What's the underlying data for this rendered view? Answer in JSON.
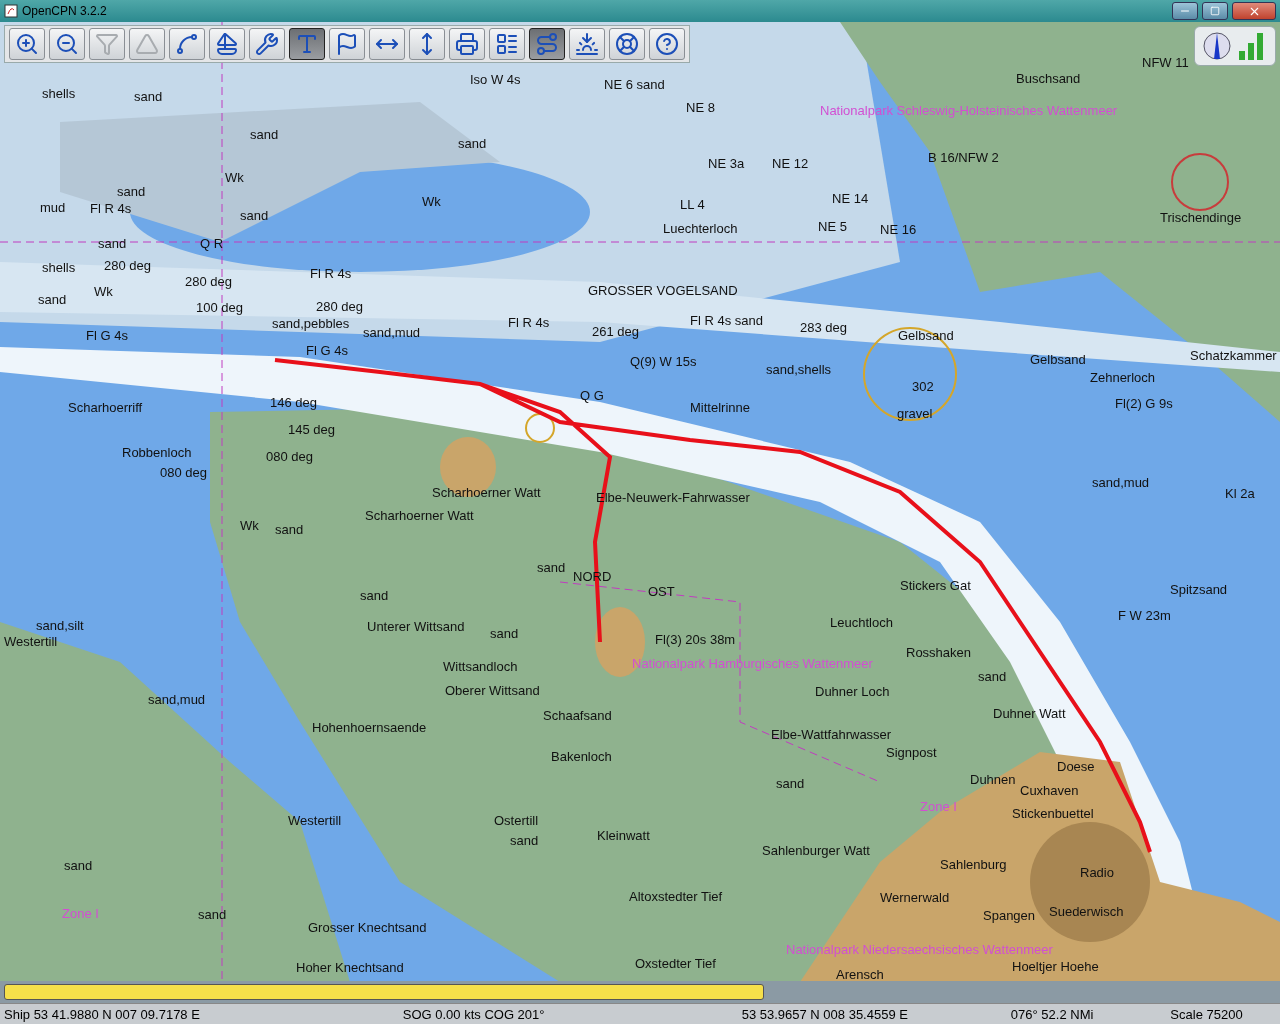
{
  "window": {
    "title": "OpenCPN 3.2.2"
  },
  "toolbar": [
    {
      "on": false,
      "disabled": false
    },
    {
      "on": false,
      "disabled": false
    },
    {
      "on": false,
      "disabled": true
    },
    {
      "on": false,
      "disabled": true
    },
    {
      "on": false,
      "disabled": false
    },
    {
      "on": false,
      "disabled": false
    },
    {
      "on": false,
      "disabled": false
    },
    {
      "on": true,
      "disabled": false
    },
    {
      "on": false,
      "disabled": false
    },
    {
      "on": false,
      "disabled": false
    },
    {
      "on": false,
      "disabled": false
    },
    {
      "on": false,
      "disabled": false
    },
    {
      "on": false,
      "disabled": false
    },
    {
      "on": true,
      "disabled": false
    },
    {
      "on": false,
      "disabled": false
    },
    {
      "on": false,
      "disabled": false
    },
    {
      "on": false,
      "disabled": false
    }
  ],
  "chart_labels": [
    {
      "text": "shells",
      "kind": "place"
    },
    {
      "text": "sand",
      "kind": "place"
    },
    {
      "text": "sand",
      "kind": "place"
    },
    {
      "text": "sand",
      "kind": "place"
    },
    {
      "text": "sand",
      "kind": "place"
    },
    {
      "text": "Wk",
      "kind": "place"
    },
    {
      "text": "mud",
      "kind": "place"
    },
    {
      "text": "Fl R 4s",
      "kind": "place"
    },
    {
      "text": "sand",
      "kind": "place"
    },
    {
      "text": "Wk",
      "kind": "place"
    },
    {
      "text": "sand",
      "kind": "place"
    },
    {
      "text": "Q R",
      "kind": "place"
    },
    {
      "text": "shells",
      "kind": "place"
    },
    {
      "text": "280 deg",
      "kind": "place"
    },
    {
      "text": "Fl R 4s",
      "kind": "place"
    },
    {
      "text": "280 deg",
      "kind": "place"
    },
    {
      "text": "Wk",
      "kind": "place"
    },
    {
      "text": "sand",
      "kind": "place"
    },
    {
      "text": "100 deg",
      "kind": "place"
    },
    {
      "text": "280 deg",
      "kind": "place"
    },
    {
      "text": "GROSSER VOGELSAND",
      "kind": "place"
    },
    {
      "text": "Fl G 4s",
      "kind": "place"
    },
    {
      "text": "sand,pebbles",
      "kind": "place"
    },
    {
      "text": "sand,mud",
      "kind": "place"
    },
    {
      "text": "Fl R 4s",
      "kind": "place"
    },
    {
      "text": "261 deg",
      "kind": "place"
    },
    {
      "text": "Fl R 4s sand",
      "kind": "place"
    },
    {
      "text": "283 deg",
      "kind": "place"
    },
    {
      "text": "Fl G 4s",
      "kind": "place"
    },
    {
      "text": "Gelbsand",
      "kind": "place"
    },
    {
      "text": "Q(9) W 15s",
      "kind": "place"
    },
    {
      "text": "Q G",
      "kind": "place"
    },
    {
      "text": "Mittelrinne",
      "kind": "place"
    },
    {
      "text": "sand,shells",
      "kind": "place"
    },
    {
      "text": "302",
      "kind": "place"
    },
    {
      "text": "gravel",
      "kind": "place"
    },
    {
      "text": "Scharhoerriff",
      "kind": "place"
    },
    {
      "text": "146 deg",
      "kind": "place"
    },
    {
      "text": "145 deg",
      "kind": "place"
    },
    {
      "text": "080 deg",
      "kind": "place"
    },
    {
      "text": "Robbenloch",
      "kind": "place"
    },
    {
      "text": "080 deg",
      "kind": "place"
    },
    {
      "text": "Scharhoerner Watt",
      "kind": "place"
    },
    {
      "text": "Scharhoerner Watt",
      "kind": "place"
    },
    {
      "text": "Elbe-Neuwerk-Fahrwasser",
      "kind": "place"
    },
    {
      "text": "sand",
      "kind": "place"
    },
    {
      "text": "sand",
      "kind": "place"
    },
    {
      "text": "NORD",
      "kind": "place"
    },
    {
      "text": "OST",
      "kind": "place"
    },
    {
      "text": "Fl(3) 20s 38m",
      "kind": "place"
    },
    {
      "text": "Nationalpark Hamburgisches Wattenmeer",
      "kind": "zone"
    },
    {
      "text": "sand",
      "kind": "place"
    },
    {
      "text": "Unterer Wittsand",
      "kind": "place"
    },
    {
      "text": "sand",
      "kind": "place"
    },
    {
      "text": "Wittsandloch",
      "kind": "place"
    },
    {
      "text": "Oberer Wittsand",
      "kind": "place"
    },
    {
      "text": "Schaafsand",
      "kind": "place"
    },
    {
      "text": "Bakenloch",
      "kind": "place"
    },
    {
      "text": "Hohenhoernsaende",
      "kind": "place"
    },
    {
      "text": "Westertill",
      "kind": "place"
    },
    {
      "text": "Ostertill",
      "kind": "place"
    },
    {
      "text": "Kleinwatt",
      "kind": "place"
    },
    {
      "text": "Sahlenburger Watt",
      "kind": "place"
    },
    {
      "text": "Altoxstedter Tief",
      "kind": "place"
    },
    {
      "text": "Grosser Knechtsand",
      "kind": "place"
    },
    {
      "text": "Hoher Knechtsand",
      "kind": "place"
    },
    {
      "text": "Oxstedter Tief",
      "kind": "place"
    },
    {
      "text": "Wernerwald",
      "kind": "place"
    },
    {
      "text": "Sahlenburg",
      "kind": "place"
    },
    {
      "text": "Spangen",
      "kind": "place"
    },
    {
      "text": "Suederwisch",
      "kind": "place"
    },
    {
      "text": "Radio",
      "kind": "place"
    },
    {
      "text": "Duhnen",
      "kind": "place"
    },
    {
      "text": "Doese",
      "kind": "place"
    },
    {
      "text": "Cuxhaven",
      "kind": "place"
    },
    {
      "text": "Stickenbuettel",
      "kind": "place"
    },
    {
      "text": "Hoeltjer Hoehe",
      "kind": "place"
    },
    {
      "text": "Nationalpark Niedersaechsisches Wattenmeer",
      "kind": "zone"
    },
    {
      "text": "Arensch",
      "kind": "place"
    },
    {
      "text": "Signpost",
      "kind": "place"
    },
    {
      "text": "Duhner Loch",
      "kind": "place"
    },
    {
      "text": "Duhner Watt",
      "kind": "place"
    },
    {
      "text": "Rosshaken",
      "kind": "place"
    },
    {
      "text": "Leuchtloch",
      "kind": "place"
    },
    {
      "text": "Elbe-Wattfahrwasser",
      "kind": "place"
    },
    {
      "text": "Stickers Gat",
      "kind": "place"
    },
    {
      "text": "Zone I",
      "kind": "zone"
    },
    {
      "text": "Luechterloch",
      "kind": "place"
    },
    {
      "text": "LL 4",
      "kind": "place"
    },
    {
      "text": "Nationalpark Schleswig-Holsteinisches Wattenmeer",
      "kind": "zone"
    },
    {
      "text": "Buschsand",
      "kind": "place"
    },
    {
      "text": "NFW 11",
      "kind": "place"
    },
    {
      "text": "Trischendinge",
      "kind": "place"
    },
    {
      "text": "Schatzkammer",
      "kind": "place"
    },
    {
      "text": "Gelbsand",
      "kind": "place"
    },
    {
      "text": "Zehnerloch",
      "kind": "place"
    },
    {
      "text": "Spitzsand",
      "kind": "place"
    },
    {
      "text": "sand,mud",
      "kind": "place"
    },
    {
      "text": "NE 6 sand",
      "kind": "place"
    },
    {
      "text": "NE 8",
      "kind": "place"
    },
    {
      "text": "NE 3a",
      "kind": "place"
    },
    {
      "text": "NE 12",
      "kind": "place"
    },
    {
      "text": "NE 14",
      "kind": "place"
    },
    {
      "text": "NE 5",
      "kind": "place"
    },
    {
      "text": "NE 16",
      "kind": "place"
    },
    {
      "text": "B 16/NFW 2",
      "kind": "place"
    },
    {
      "text": "Iso W 4s",
      "kind": "place"
    },
    {
      "text": "Fl(2) G 9s",
      "kind": "place"
    },
    {
      "text": "Kl 2a",
      "kind": "place"
    },
    {
      "text": "F W 23m",
      "kind": "place"
    },
    {
      "text": "sand,silt",
      "kind": "place"
    },
    {
      "text": "sand,mud",
      "kind": "place"
    },
    {
      "text": "Westertill",
      "kind": "place"
    },
    {
      "text": "Zone I",
      "kind": "zone"
    },
    {
      "text": "Wk",
      "kind": "place"
    },
    {
      "text": "sand",
      "kind": "place"
    },
    {
      "text": "sand",
      "kind": "place"
    },
    {
      "text": "sand",
      "kind": "place"
    },
    {
      "text": "sand",
      "kind": "place"
    },
    {
      "text": "sand",
      "kind": "place"
    }
  ],
  "status_bar": {
    "ship": "Ship 53 41.9880 N   007 09.7178 E",
    "speed": "SOG 0.00 kts  COG 201°",
    "cursor": "53 53.9657 N   008 35.4559 E",
    "bearing": "076°  52.2 NMi",
    "scale": "Scale 75200"
  }
}
